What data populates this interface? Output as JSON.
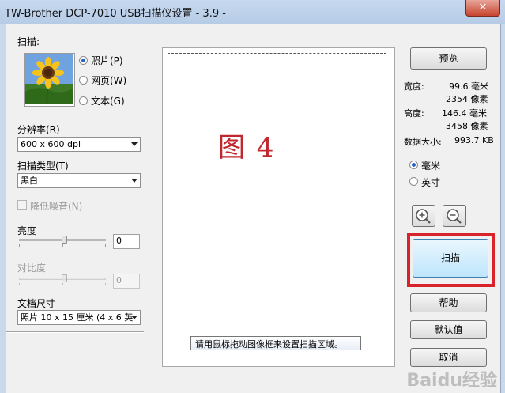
{
  "window": {
    "title": "TW-Brother DCP-7010 USB扫描仪设置 - 3.9 -",
    "close": "✕"
  },
  "scan": {
    "label": "扫描:",
    "options": [
      {
        "label": "照片(P)",
        "selected": true
      },
      {
        "label": "网页(W)",
        "selected": false
      },
      {
        "label": "文本(G)",
        "selected": false
      }
    ]
  },
  "resolution": {
    "label": "分辨率(R)",
    "value": "600 x 600 dpi"
  },
  "scan_type": {
    "label": "扫描类型(T)",
    "value": "黑白"
  },
  "denoise": {
    "label": "降低噪音(N)"
  },
  "brightness": {
    "label": "亮度",
    "value": "0"
  },
  "contrast": {
    "label": "对比度",
    "value": "0"
  },
  "doc_size": {
    "label": "文档尺寸",
    "value": "照片 10 x 15 厘米 (4 x 6 英"
  },
  "preview_area": {
    "annotation": "图  4",
    "tooltip": "请用鼠标拖动图像框来设置扫描区域。"
  },
  "buttons": {
    "preview": "预览",
    "scan": "扫描",
    "help": "帮助",
    "default": "默认值",
    "cancel": "取消"
  },
  "info": {
    "width_label": "宽度:",
    "width_mm": "99.6 毫米",
    "width_px": "2354 像素",
    "height_label": "高度:",
    "height_mm": "146.4 毫米",
    "height_px": "3458 像素",
    "size_label": "数据大小:",
    "size_value": "993.7 KB"
  },
  "units": [
    {
      "label": "毫米",
      "selected": true
    },
    {
      "label": "英寸",
      "selected": false
    }
  ],
  "watermark": "Baidu经验",
  "colors": {
    "highlight": "#d9232a",
    "annotation": "#c0282e"
  }
}
